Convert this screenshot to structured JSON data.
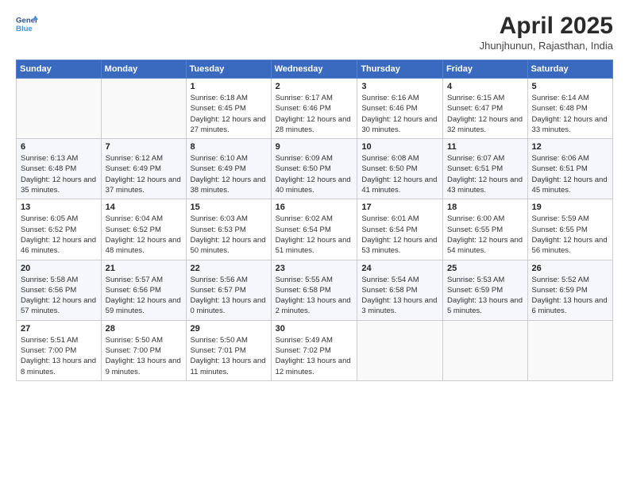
{
  "logo": {
    "line1": "General",
    "line2": "Blue"
  },
  "title": "April 2025",
  "subtitle": "Jhunjhunun, Rajasthan, India",
  "headers": [
    "Sunday",
    "Monday",
    "Tuesday",
    "Wednesday",
    "Thursday",
    "Friday",
    "Saturday"
  ],
  "weeks": [
    [
      {
        "num": "",
        "info": ""
      },
      {
        "num": "",
        "info": ""
      },
      {
        "num": "1",
        "info": "Sunrise: 6:18 AM\nSunset: 6:45 PM\nDaylight: 12 hours and 27 minutes."
      },
      {
        "num": "2",
        "info": "Sunrise: 6:17 AM\nSunset: 6:46 PM\nDaylight: 12 hours and 28 minutes."
      },
      {
        "num": "3",
        "info": "Sunrise: 6:16 AM\nSunset: 6:46 PM\nDaylight: 12 hours and 30 minutes."
      },
      {
        "num": "4",
        "info": "Sunrise: 6:15 AM\nSunset: 6:47 PM\nDaylight: 12 hours and 32 minutes."
      },
      {
        "num": "5",
        "info": "Sunrise: 6:14 AM\nSunset: 6:48 PM\nDaylight: 12 hours and 33 minutes."
      }
    ],
    [
      {
        "num": "6",
        "info": "Sunrise: 6:13 AM\nSunset: 6:48 PM\nDaylight: 12 hours and 35 minutes."
      },
      {
        "num": "7",
        "info": "Sunrise: 6:12 AM\nSunset: 6:49 PM\nDaylight: 12 hours and 37 minutes."
      },
      {
        "num": "8",
        "info": "Sunrise: 6:10 AM\nSunset: 6:49 PM\nDaylight: 12 hours and 38 minutes."
      },
      {
        "num": "9",
        "info": "Sunrise: 6:09 AM\nSunset: 6:50 PM\nDaylight: 12 hours and 40 minutes."
      },
      {
        "num": "10",
        "info": "Sunrise: 6:08 AM\nSunset: 6:50 PM\nDaylight: 12 hours and 41 minutes."
      },
      {
        "num": "11",
        "info": "Sunrise: 6:07 AM\nSunset: 6:51 PM\nDaylight: 12 hours and 43 minutes."
      },
      {
        "num": "12",
        "info": "Sunrise: 6:06 AM\nSunset: 6:51 PM\nDaylight: 12 hours and 45 minutes."
      }
    ],
    [
      {
        "num": "13",
        "info": "Sunrise: 6:05 AM\nSunset: 6:52 PM\nDaylight: 12 hours and 46 minutes."
      },
      {
        "num": "14",
        "info": "Sunrise: 6:04 AM\nSunset: 6:52 PM\nDaylight: 12 hours and 48 minutes."
      },
      {
        "num": "15",
        "info": "Sunrise: 6:03 AM\nSunset: 6:53 PM\nDaylight: 12 hours and 50 minutes."
      },
      {
        "num": "16",
        "info": "Sunrise: 6:02 AM\nSunset: 6:54 PM\nDaylight: 12 hours and 51 minutes."
      },
      {
        "num": "17",
        "info": "Sunrise: 6:01 AM\nSunset: 6:54 PM\nDaylight: 12 hours and 53 minutes."
      },
      {
        "num": "18",
        "info": "Sunrise: 6:00 AM\nSunset: 6:55 PM\nDaylight: 12 hours and 54 minutes."
      },
      {
        "num": "19",
        "info": "Sunrise: 5:59 AM\nSunset: 6:55 PM\nDaylight: 12 hours and 56 minutes."
      }
    ],
    [
      {
        "num": "20",
        "info": "Sunrise: 5:58 AM\nSunset: 6:56 PM\nDaylight: 12 hours and 57 minutes."
      },
      {
        "num": "21",
        "info": "Sunrise: 5:57 AM\nSunset: 6:56 PM\nDaylight: 12 hours and 59 minutes."
      },
      {
        "num": "22",
        "info": "Sunrise: 5:56 AM\nSunset: 6:57 PM\nDaylight: 13 hours and 0 minutes."
      },
      {
        "num": "23",
        "info": "Sunrise: 5:55 AM\nSunset: 6:58 PM\nDaylight: 13 hours and 2 minutes."
      },
      {
        "num": "24",
        "info": "Sunrise: 5:54 AM\nSunset: 6:58 PM\nDaylight: 13 hours and 3 minutes."
      },
      {
        "num": "25",
        "info": "Sunrise: 5:53 AM\nSunset: 6:59 PM\nDaylight: 13 hours and 5 minutes."
      },
      {
        "num": "26",
        "info": "Sunrise: 5:52 AM\nSunset: 6:59 PM\nDaylight: 13 hours and 6 minutes."
      }
    ],
    [
      {
        "num": "27",
        "info": "Sunrise: 5:51 AM\nSunset: 7:00 PM\nDaylight: 13 hours and 8 minutes."
      },
      {
        "num": "28",
        "info": "Sunrise: 5:50 AM\nSunset: 7:00 PM\nDaylight: 13 hours and 9 minutes."
      },
      {
        "num": "29",
        "info": "Sunrise: 5:50 AM\nSunset: 7:01 PM\nDaylight: 13 hours and 11 minutes."
      },
      {
        "num": "30",
        "info": "Sunrise: 5:49 AM\nSunset: 7:02 PM\nDaylight: 13 hours and 12 minutes."
      },
      {
        "num": "",
        "info": ""
      },
      {
        "num": "",
        "info": ""
      },
      {
        "num": "",
        "info": ""
      }
    ]
  ]
}
